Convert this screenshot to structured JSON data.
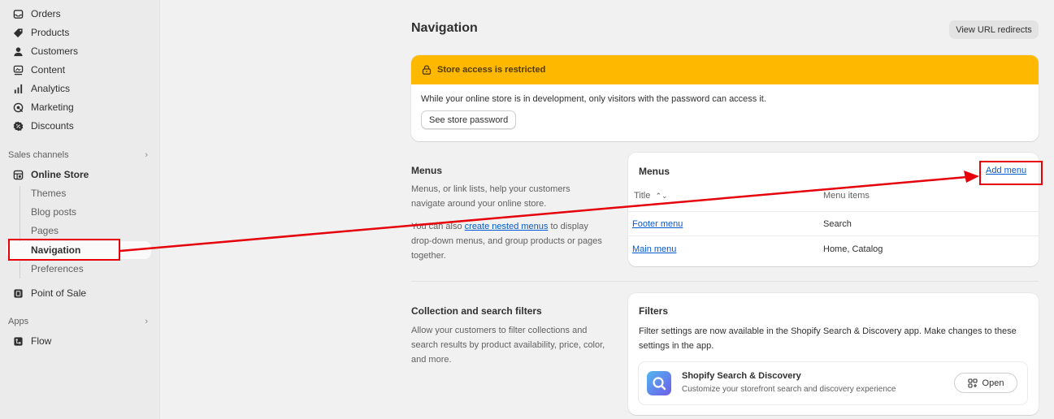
{
  "sidebar": {
    "items": [
      {
        "label": "Orders",
        "icon": "orders-icon"
      },
      {
        "label": "Products",
        "icon": "tag-icon"
      },
      {
        "label": "Customers",
        "icon": "person-icon"
      },
      {
        "label": "Content",
        "icon": "content-icon"
      },
      {
        "label": "Analytics",
        "icon": "bar-chart-icon"
      },
      {
        "label": "Marketing",
        "icon": "target-icon"
      },
      {
        "label": "Discounts",
        "icon": "discount-icon"
      }
    ],
    "sales_channels_label": "Sales channels",
    "online_store_label": "Online Store",
    "sub_items": [
      "Themes",
      "Blog posts",
      "Pages",
      "Navigation",
      "Preferences"
    ],
    "point_of_sale_label": "Point of Sale",
    "apps_label": "Apps",
    "flow_label": "Flow"
  },
  "header": {
    "title": "Navigation",
    "redirects_button": "View URL redirects"
  },
  "banner": {
    "title": "Store access is restricted",
    "message": "While your online store is in development, only visitors with the password can access it.",
    "button": "See store password"
  },
  "menus_section": {
    "title": "Menus",
    "desc_1": "Menus, or link lists, help your customers navigate around your online store.",
    "desc_2_prefix": "You can also ",
    "desc_2_link": "create nested menus",
    "desc_2_suffix": " to display drop-down menus, and group products or pages together.",
    "card_title": "Menus",
    "add_menu": "Add menu",
    "col_title": "Title",
    "col_items": "Menu items",
    "sort_icon": "sort-icon",
    "rows": [
      {
        "title": "Footer menu",
        "items": "Search"
      },
      {
        "title": "Main menu",
        "items": "Home, Catalog"
      }
    ]
  },
  "filters_section": {
    "title": "Collection and search filters",
    "desc": "Allow your customers to filter collections and search results by product availability, price, color, and more.",
    "card_title": "Filters",
    "card_text": "Filter settings are now available in the Shopify Search & Discovery app. Make changes to these settings in the app.",
    "app_name": "Shopify Search & Discovery",
    "app_desc": "Customize your storefront search and discovery experience",
    "open_button": "Open"
  },
  "colors": {
    "accent_link": "#005bd3",
    "banner_warning": "#ffb800",
    "annotation": "#e5000a"
  }
}
